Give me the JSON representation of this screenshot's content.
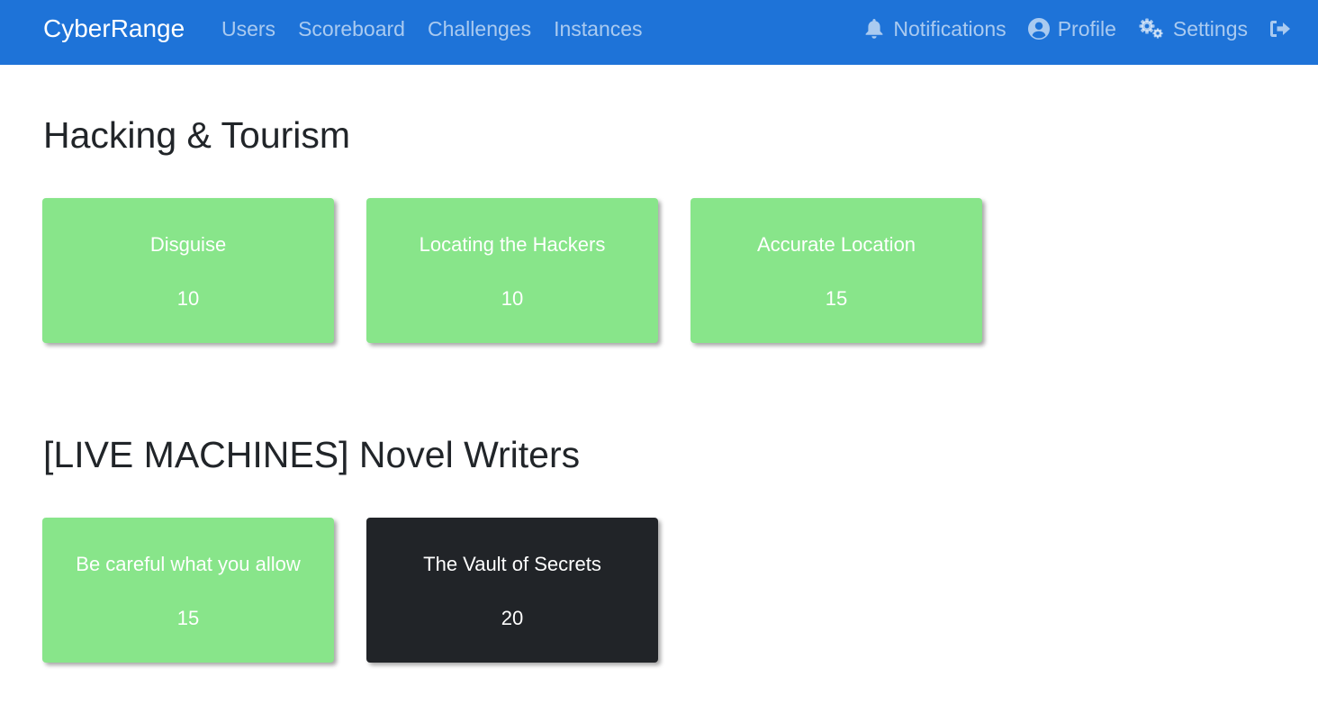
{
  "navbar": {
    "brand": "CyberRange",
    "left_links": [
      "Users",
      "Scoreboard",
      "Challenges",
      "Instances"
    ],
    "notifications_label": "Notifications",
    "profile_label": "Profile",
    "settings_label": "Settings",
    "icons": {
      "notifications": "bell-icon",
      "profile": "user-circle-icon",
      "settings": "gears-icon",
      "logout": "sign-out-icon"
    }
  },
  "categories": [
    {
      "title": "Hacking & Tourism",
      "challenges": [
        {
          "name": "Disguise",
          "value": "10",
          "status": "solved"
        },
        {
          "name": "Locating the Hackers",
          "value": "10",
          "status": "solved"
        },
        {
          "name": "Accurate Location",
          "value": "15",
          "status": "solved"
        }
      ]
    },
    {
      "title": "[LIVE MACHINES] Novel Writers",
      "challenges": [
        {
          "name": "Be careful what you allow",
          "value": "15",
          "status": "solved"
        },
        {
          "name": "The Vault of Secrets",
          "value": "20",
          "status": "unsolved"
        }
      ]
    }
  ],
  "colors": {
    "navbar": "#1e73d8",
    "solved_card": "#88e58a",
    "unsolved_card": "#212428"
  }
}
